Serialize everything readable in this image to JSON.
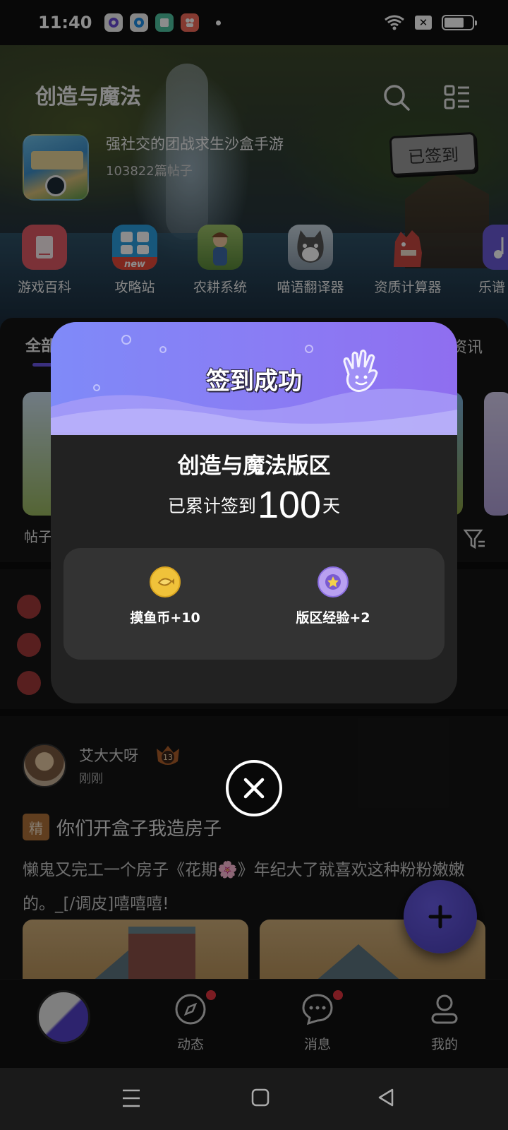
{
  "status_bar": {
    "time": "11:40",
    "nosim_label": "✕"
  },
  "forum": {
    "title": "创造与魔法",
    "description": "强社交的团战求生沙盒手游",
    "post_count": "103822篇帖子",
    "signed_label": "已签到",
    "tools": [
      {
        "label": "游戏百科",
        "icon": "book-icon"
      },
      {
        "label": "攻略站",
        "icon": "grid-new-icon"
      },
      {
        "label": "农耕系统",
        "icon": "farmer-icon"
      },
      {
        "label": "喵语翻译器",
        "icon": "cat-icon"
      },
      {
        "label": "资质计算器",
        "icon": "dragon-icon"
      },
      {
        "label": "乐谱",
        "icon": "music-icon"
      }
    ]
  },
  "tabs": {
    "first": "全部",
    "last": "资讯"
  },
  "section_label": "帖子",
  "post": {
    "author": "艾大大呀",
    "level": "13",
    "time": "刚刚",
    "tag": "精",
    "title": "你们开盒子我造房子",
    "body": "懒鬼又完工一个房子《花期🌸》年纪大了就喜欢这种粉粉嫩嫩的。_[/调皮]嘻嘻嘻!"
  },
  "bottom_nav": [
    {
      "label": "动态",
      "icon": "compass-icon",
      "badge": true
    },
    {
      "label": "消息",
      "icon": "chat-icon",
      "badge": true
    },
    {
      "label": "我的",
      "icon": "person-icon",
      "badge": false
    }
  ],
  "modal": {
    "title": "签到成功",
    "forum_name": "创造与魔法版区",
    "days_prefix": "已累计签到",
    "days_count": "100",
    "days_suffix": "天",
    "rewards": [
      {
        "label": "摸鱼币+10",
        "icon": "fish-coin-icon",
        "color": "#f0c23a"
      },
      {
        "label": "版区经验+2",
        "icon": "star-badge-icon",
        "color": "#8a6ee0"
      }
    ]
  },
  "colors": {
    "accent": "#6a56e6",
    "modal_header": "#8a7cf4",
    "badge_red": "#e0343e"
  }
}
